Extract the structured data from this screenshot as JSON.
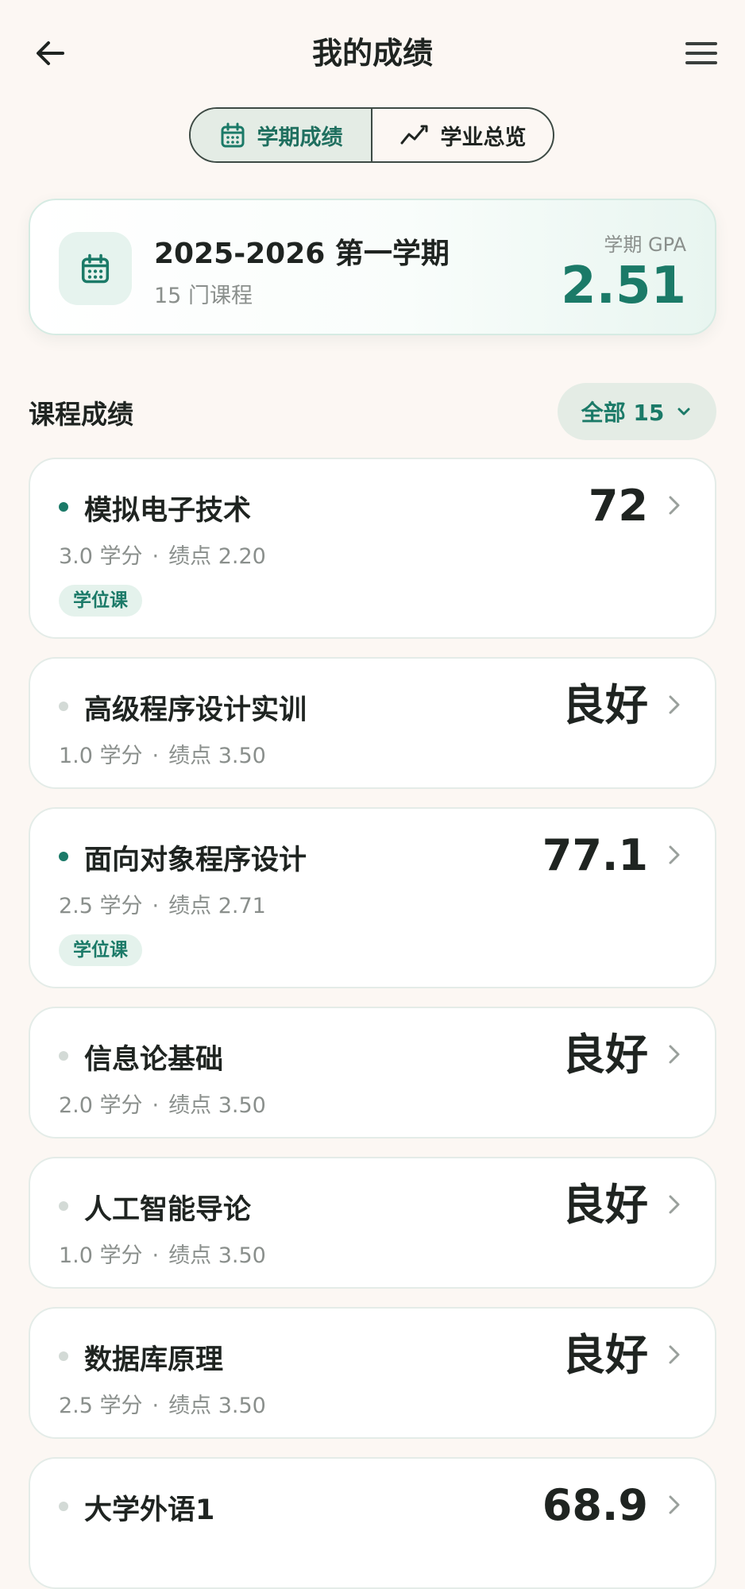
{
  "header": {
    "title": "我的成绩"
  },
  "tabs": [
    {
      "label": "学期成绩",
      "icon": "calendar-icon",
      "active": true
    },
    {
      "label": "学业总览",
      "icon": "trend-icon",
      "active": false
    }
  ],
  "term": {
    "name": "2025-2026 第一学期",
    "course_count": "15 门课程",
    "gpa_label": "学期 GPA",
    "gpa": "2.51"
  },
  "section": {
    "title": "课程成绩",
    "filter_label": "全部 15"
  },
  "courses": [
    {
      "name": "模拟电子技术",
      "score": "72",
      "credits": "3.0 学分",
      "gpa": "绩点 2.20",
      "tag": "学位课",
      "degree": true
    },
    {
      "name": "高级程序设计实训",
      "score": "良好",
      "credits": "1.0 学分",
      "gpa": "绩点 3.50",
      "tag": "",
      "degree": false
    },
    {
      "name": "面向对象程序设计",
      "score": "77.1",
      "credits": "2.5 学分",
      "gpa": "绩点 2.71",
      "tag": "学位课",
      "degree": true
    },
    {
      "name": "信息论基础",
      "score": "良好",
      "credits": "2.0 学分",
      "gpa": "绩点 3.50",
      "tag": "",
      "degree": false
    },
    {
      "name": "人工智能导论",
      "score": "良好",
      "credits": "1.0 学分",
      "gpa": "绩点 3.50",
      "tag": "",
      "degree": false
    },
    {
      "name": "数据库原理",
      "score": "良好",
      "credits": "2.5 学分",
      "gpa": "绩点 3.50",
      "tag": "",
      "degree": false
    },
    {
      "name": "大学外语1",
      "score": "68.9",
      "credits": "",
      "gpa": "",
      "tag": "",
      "degree": false
    }
  ],
  "colors": {
    "accent": "#1b7a68",
    "background": "#fcf7f3",
    "tab_active_bg": "#e4ece5"
  }
}
